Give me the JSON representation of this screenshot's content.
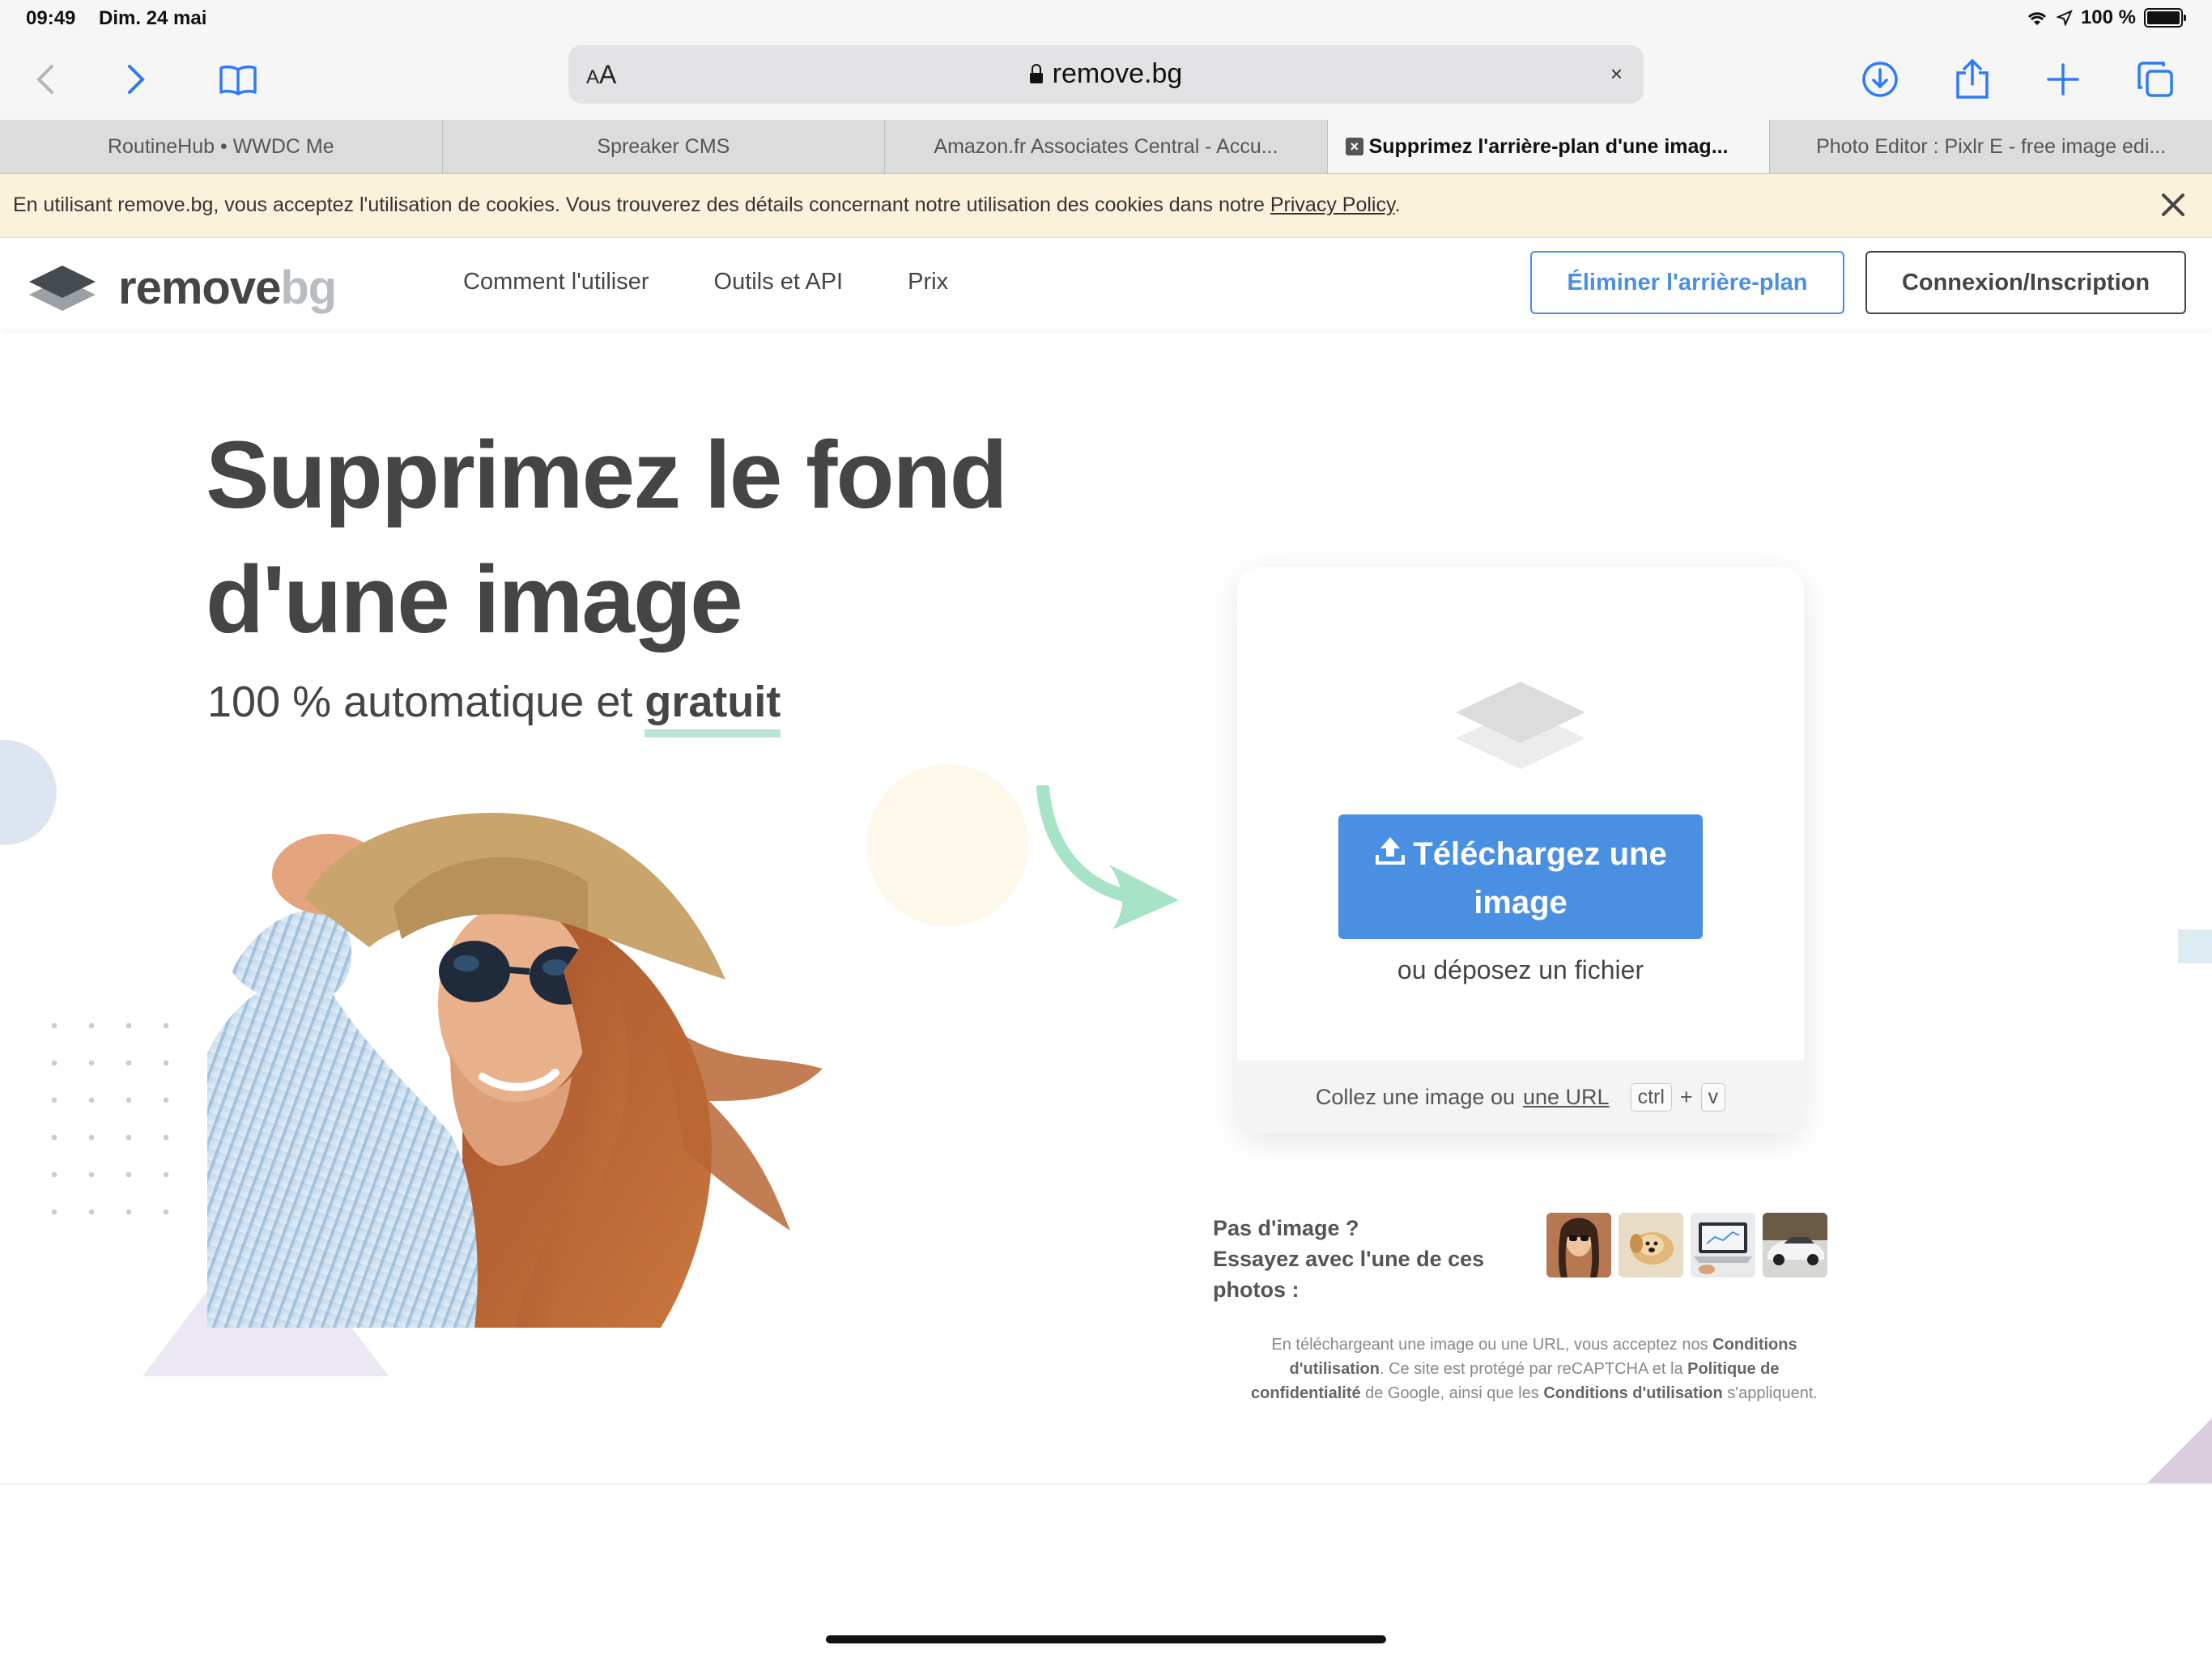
{
  "status_bar": {
    "time": "09:49",
    "date": "Dim. 24 mai",
    "battery": "100 %"
  },
  "browser": {
    "text_size_label": "AA",
    "address": "remove.bg",
    "tabs": [
      {
        "title": "RoutineHub • WWDC Me",
        "active": false
      },
      {
        "title": "Spreaker CMS",
        "active": false
      },
      {
        "title": "Amazon.fr Associates Central - Accu...",
        "active": false
      },
      {
        "title": "Supprimez l'arrière-plan d'une imag...",
        "active": true
      },
      {
        "title": "Photo Editor : Pixlr E - free image edi...",
        "active": false
      }
    ]
  },
  "cookie_bar": {
    "message": "En utilisant remove.bg, vous acceptez l'utilisation de cookies. Vous trouverez des détails concernant notre utilisation des cookies dans notre ",
    "link": "Privacy Policy",
    "end": "."
  },
  "site": {
    "logo_primary": "remove",
    "logo_secondary": "bg",
    "nav": [
      "Comment l'utiliser",
      "Outils et API",
      "Prix"
    ],
    "cta_remove": "Éliminer l'arrière-plan",
    "cta_login": "Connexion/Inscription"
  },
  "hero": {
    "title_line1": "Supprimez le fond",
    "title_line2": "d'une image",
    "subtitle_prefix": "100 % automatique et ",
    "subtitle_highlight": "gratuit"
  },
  "upload": {
    "button_line1": "Téléchargez une",
    "button_line2": "image",
    "drop_text": "ou déposez un fichier",
    "paste_prefix": "Collez une image ou ",
    "paste_link": "une URL",
    "key_ctrl": "ctrl",
    "key_plus": "+",
    "key_v": "v"
  },
  "samples": {
    "label_line1": "Pas d'image ?",
    "label_line2": "Essayez avec l'une de ces",
    "label_line3": "photos :",
    "thumbs": [
      "woman-photo",
      "dog-photo",
      "laptop-photo",
      "car-photo"
    ]
  },
  "legal": {
    "p1": "En téléchargeant une image ou une URL, vous acceptez nos ",
    "b1": "Conditions d'utilisation",
    "p2": ". Ce site est protégé par reCAPTCHA et la ",
    "b2": "Politique de confidentialité",
    "p3": " de Google, ainsi que les ",
    "b3": "Conditions d'utilisation",
    "p4": " s'appliquent."
  },
  "colors": {
    "accent_blue": "#4a90e2",
    "text_dark": "#454545",
    "highlight_green": "#b8e6d2",
    "arrow_green": "#a6e3c7",
    "cookie_bg": "#fbf2dc"
  }
}
